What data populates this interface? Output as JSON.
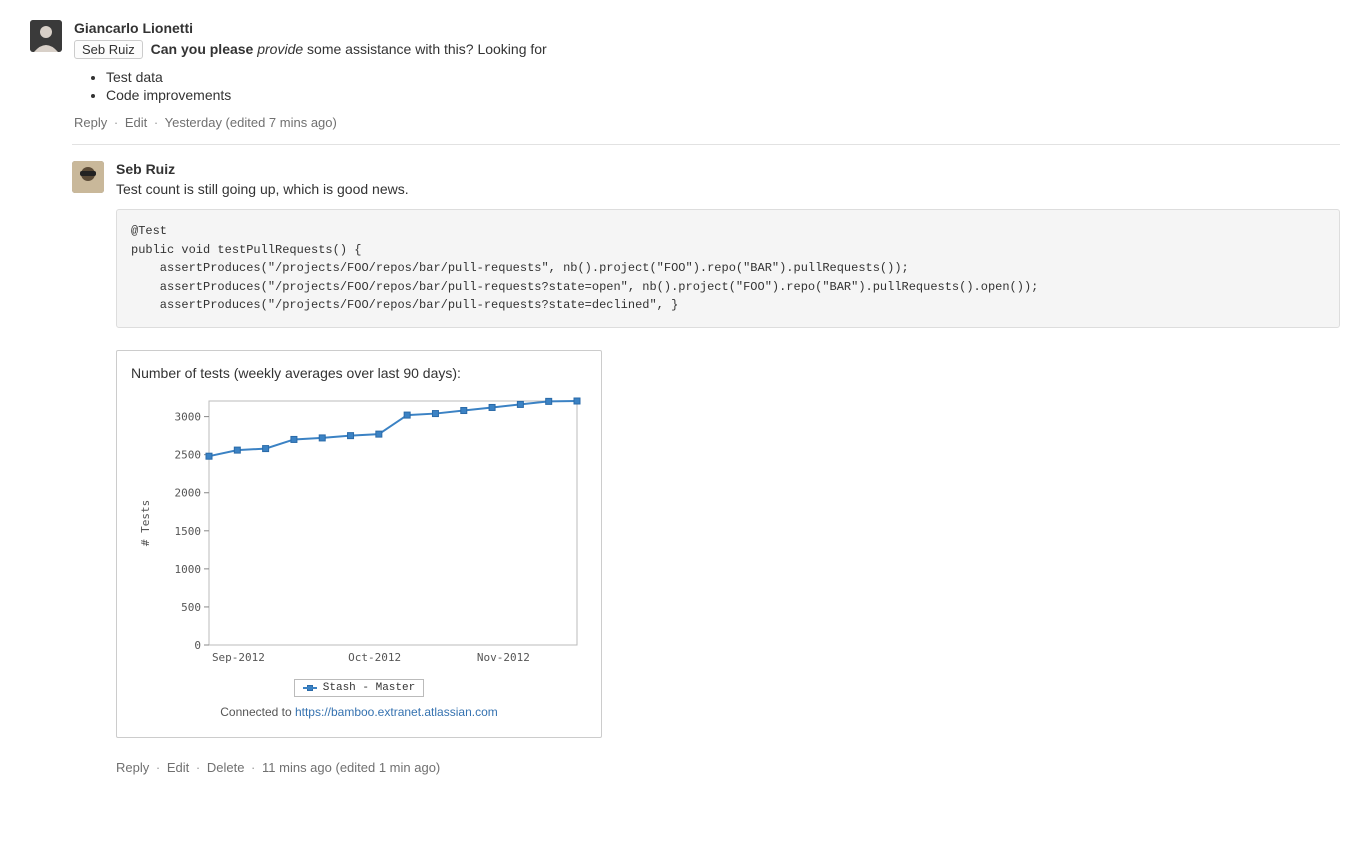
{
  "comments": [
    {
      "author": "Giancarlo Lionetti",
      "mention": "Seb Ruiz",
      "text_bold": "Can you please ",
      "text_italic": "provide ",
      "text_plain": "some assistance with this? Looking for",
      "bullets": [
        "Test data",
        "Code improvements"
      ],
      "actions": {
        "reply": "Reply",
        "edit": "Edit",
        "timestamp": "Yesterday (edited 7 mins ago)"
      }
    },
    {
      "author": "Seb Ruiz",
      "text": "Test count is still going up, which is good news.",
      "code": "@Test\npublic void testPullRequests() {\n    assertProduces(\"/projects/FOO/repos/bar/pull-requests\", nb().project(\"FOO\").repo(\"BAR\").pullRequests());\n    assertProduces(\"/projects/FOO/repos/bar/pull-requests?state=open\", nb().project(\"FOO\").repo(\"BAR\").pullRequests().open());\n    assertProduces(\"/projects/FOO/repos/bar/pull-requests?state=declined\", }",
      "chart_title": "Number of tests  (weekly averages over last 90 days):",
      "chart_footer_prefix": "Connected to ",
      "chart_footer_link": "https://bamboo.extranet.atlassian.com",
      "actions": {
        "reply": "Reply",
        "edit": "Edit",
        "delete": "Delete",
        "timestamp": "11 mins ago (edited 1 min ago)"
      }
    }
  ],
  "chart_data": {
    "type": "line",
    "title": "Number of tests  (weekly averages over last 90 days)",
    "xlabel": "",
    "ylabel": "# Tests",
    "x_ticks": [
      "Sep-2012",
      "Oct-2012",
      "Nov-2012"
    ],
    "ylim": [
      0,
      3000
    ],
    "y_ticks": [
      0,
      500,
      1000,
      1500,
      2000,
      2500,
      3000
    ],
    "series": [
      {
        "name": "Stash - Master",
        "color": "#3b82c4",
        "values": [
          2480,
          2560,
          2580,
          2700,
          2720,
          2750,
          2770,
          3020,
          3040,
          3080,
          3120,
          3160,
          3200,
          3205
        ]
      }
    ]
  }
}
